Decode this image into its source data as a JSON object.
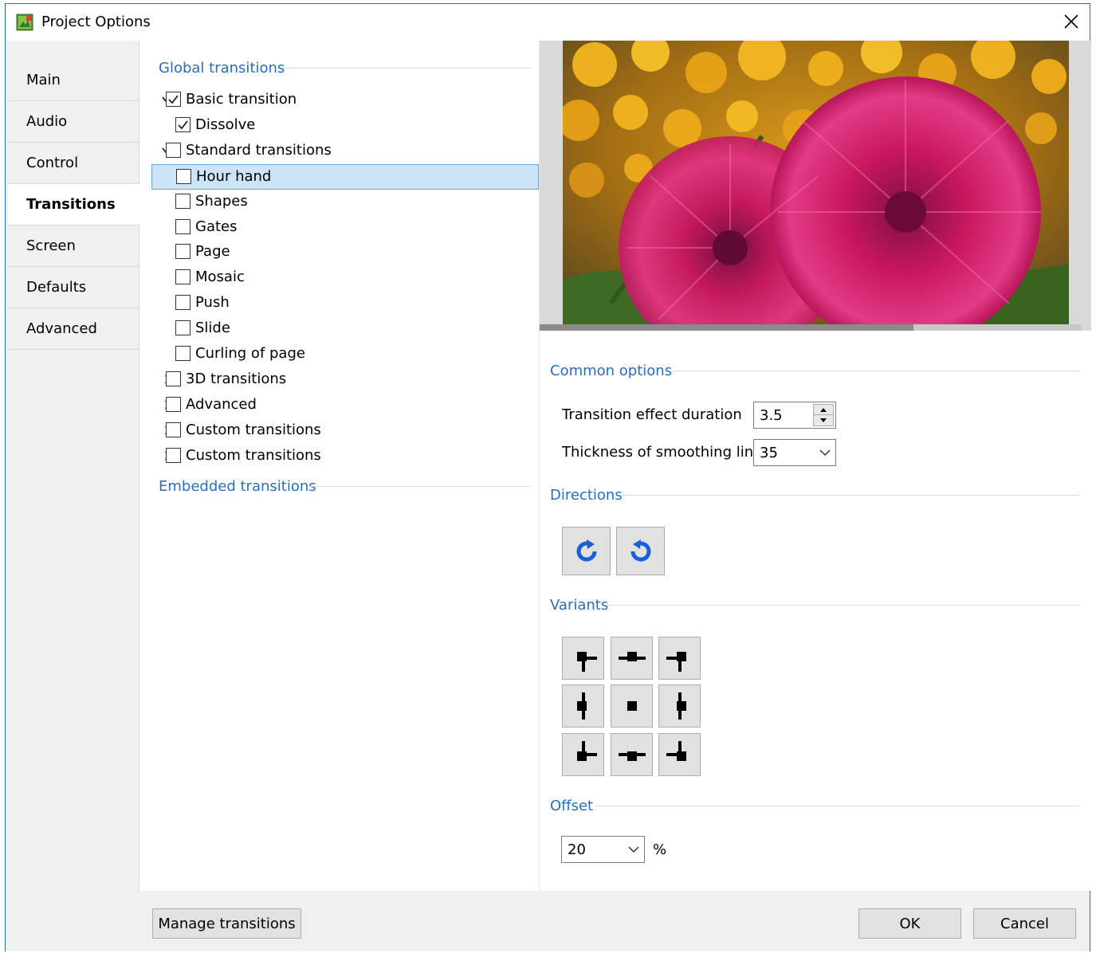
{
  "window": {
    "title": "Project Options"
  },
  "sidebar": {
    "items": [
      {
        "label": "Main"
      },
      {
        "label": "Audio"
      },
      {
        "label": "Control"
      },
      {
        "label": "Transitions",
        "active": true
      },
      {
        "label": "Screen"
      },
      {
        "label": "Defaults"
      },
      {
        "label": "Advanced"
      }
    ]
  },
  "tree": {
    "global_header": "Global transitions",
    "embedded_header": "Embedded transitions",
    "rows": [
      {
        "label": "Basic transition",
        "checked": true,
        "expander": "expanded"
      },
      {
        "label": "Dissolve",
        "checked": true
      },
      {
        "label": "Standard transitions",
        "checked": false,
        "expander": "expanded"
      },
      {
        "label": "Hour hand",
        "checked": false,
        "selected": true
      },
      {
        "label": "Shapes",
        "checked": false
      },
      {
        "label": "Gates",
        "checked": false
      },
      {
        "label": "Page",
        "checked": false
      },
      {
        "label": "Mosaic",
        "checked": false
      },
      {
        "label": "Push",
        "checked": false
      },
      {
        "label": "Slide",
        "checked": false
      },
      {
        "label": "Curling of page",
        "checked": false
      },
      {
        "label": "3D transitions",
        "checked": false,
        "expander": "collapsed"
      },
      {
        "label": "Advanced",
        "checked": false,
        "expander": "collapsed"
      },
      {
        "label": "Custom transitions",
        "checked": false,
        "expander": "collapsed"
      },
      {
        "label": "Custom transitions",
        "checked": false,
        "expander": "collapsed"
      }
    ]
  },
  "preview": {
    "progress_fraction": 0.69
  },
  "common_options": {
    "title": "Common options",
    "duration_label": "Transition effect duration",
    "duration_value": "3.5",
    "thickness_label": "Thickness of smoothing line",
    "thickness_value": "35"
  },
  "directions": {
    "title": "Directions",
    "buttons": [
      "clockwise-icon",
      "counterclockwise-icon"
    ]
  },
  "variants": {
    "title": "Variants"
  },
  "offset": {
    "title": "Offset",
    "value": "20",
    "unit": "%"
  },
  "footer": {
    "manage_label": "Manage transitions",
    "ok_label": "OK",
    "cancel_label": "Cancel"
  },
  "colors": {
    "accent": "#2a6ebb",
    "selection": "#cce4f7",
    "direction_icon": "#1a5fd6"
  }
}
